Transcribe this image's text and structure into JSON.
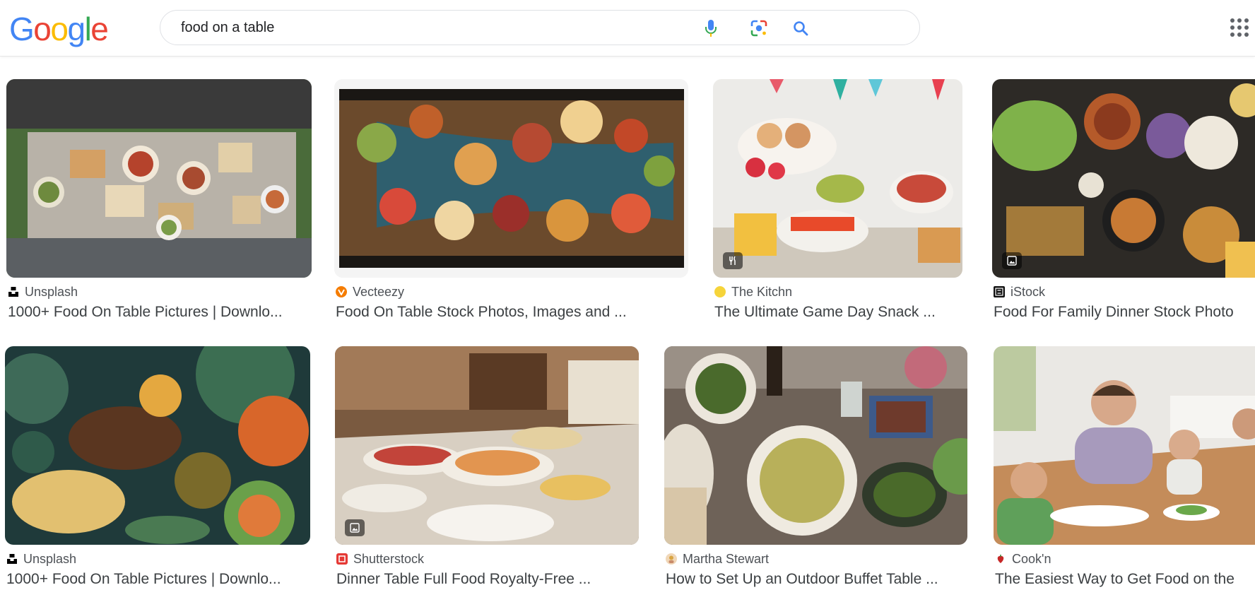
{
  "search": {
    "query": "food on a table"
  },
  "logo": {
    "letters": [
      "G",
      "o",
      "o",
      "g",
      "l",
      "e"
    ],
    "colors": [
      "#4285f4",
      "#ea4335",
      "#fbbc05",
      "#4285f4",
      "#34a853",
      "#ea4335"
    ]
  },
  "icons": {
    "voice": "microphone-icon",
    "lens": "camera-lens-icon",
    "search": "search-icon",
    "apps": "apps-grid-icon"
  },
  "results": [
    {
      "source": "Unsplash",
      "title": "1000+ Food On Table Pictures | Downlo...",
      "favicon_color": "#000000",
      "badge": ""
    },
    {
      "source": "Vecteezy",
      "title": "Food On Table Stock Photos, Images and ...",
      "favicon_color": "#f57c00",
      "badge": ""
    },
    {
      "source": "The Kitchn",
      "title": "The Ultimate Game Day Snack ...",
      "favicon_color": "#f6d43a",
      "badge": "recipe-icon"
    },
    {
      "source": "iStock",
      "title": "Food For Family Dinner Stock Photo",
      "favicon_color": "#111111",
      "badge": "image-icon"
    },
    {
      "source": "Unsplash",
      "title": "1000+ Food On Table Pictures | Downlo...",
      "favicon_color": "#000000",
      "badge": ""
    },
    {
      "source": "Shutterstock",
      "title": "Dinner Table Full Food Royalty-Free ...",
      "favicon_color": "#e53935",
      "badge": "image-icon"
    },
    {
      "source": "Martha Stewart",
      "title": "How to Set Up an Outdoor Buffet Table ...",
      "favicon_color": "#d9a441",
      "badge": ""
    },
    {
      "source": "Cook'n",
      "title": "The Easiest Way to Get Food on the",
      "favicon_color": "#c62828",
      "badge": ""
    }
  ]
}
